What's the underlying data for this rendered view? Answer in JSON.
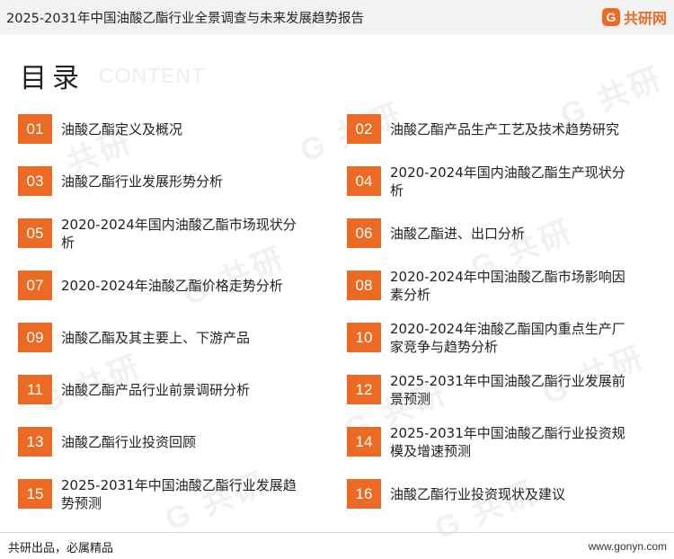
{
  "header": {
    "title": "2025-2031年中国油酸乙酯行业全景调查与未来发展趋势报告",
    "brand_logo": "G",
    "brand_name": "共研网"
  },
  "toc": {
    "title": "目录",
    "subtitle": "CONTENT",
    "items": [
      {
        "num": "01",
        "label": "油酸乙酯定义及概况"
      },
      {
        "num": "02",
        "label": "油酸乙酯产品生产工艺及技术趋势研究"
      },
      {
        "num": "03",
        "label": "油酸乙酯行业发展形势分析"
      },
      {
        "num": "04",
        "label": "2020-2024年国内油酸乙酯生产现状分析"
      },
      {
        "num": "05",
        "label": "2020-2024年国内油酸乙酯市场现状分析"
      },
      {
        "num": "06",
        "label": "油酸乙酯进、出口分析"
      },
      {
        "num": "07",
        "label": "2020-2024年油酸乙酯价格走势分析"
      },
      {
        "num": "08",
        "label": "2020-2024年中国油酸乙酯市场影响因素分析"
      },
      {
        "num": "09",
        "label": "油酸乙酯及其主要上、下游产品"
      },
      {
        "num": "10",
        "label": "2020-2024年油酸乙酯国内重点生产厂家竞争与趋势分析"
      },
      {
        "num": "11",
        "label": "油酸乙酯产品行业前景调研分析"
      },
      {
        "num": "12",
        "label": "2025-2031年中国油酸乙酯行业发展前景预测"
      },
      {
        "num": "13",
        "label": "油酸乙酯行业投资回顾"
      },
      {
        "num": "14",
        "label": "2025-2031年中国油酸乙酯行业投资规模及增速预测"
      },
      {
        "num": "15",
        "label": "2025-2031年中国油酸乙酯行业发展趋势预测"
      },
      {
        "num": "16",
        "label": "油酸乙酯行业投资现状及建议"
      }
    ]
  },
  "footer": {
    "slogan": "共研出品，必属精品",
    "url": "www.gonyn.com"
  },
  "colors": {
    "accent": "#ec6a23",
    "header_bg": "#f2f2f2"
  }
}
